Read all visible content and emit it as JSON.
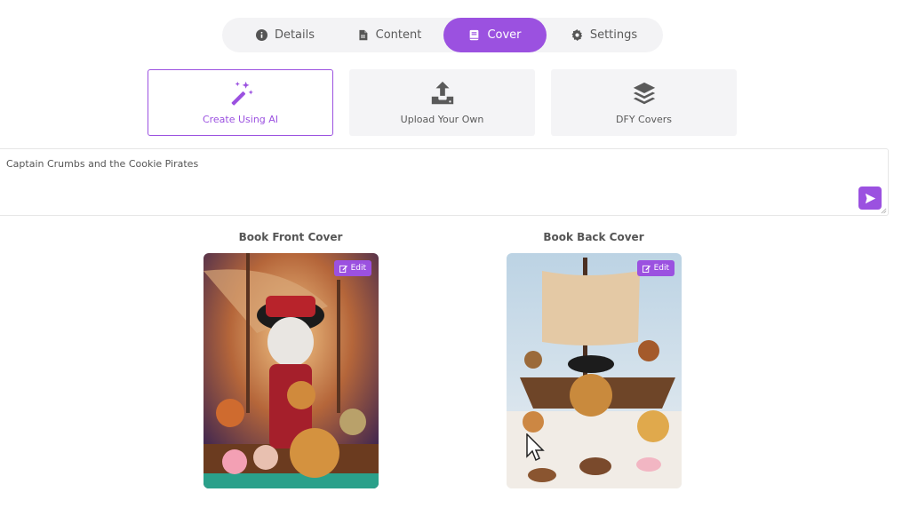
{
  "tabs": [
    {
      "label": "Details",
      "icon": "info-icon"
    },
    {
      "label": "Content",
      "icon": "file-icon"
    },
    {
      "label": "Cover",
      "icon": "book-icon",
      "active": true
    },
    {
      "label": "Settings",
      "icon": "gear-icon"
    }
  ],
  "cover_options": [
    {
      "label": "Create Using AI",
      "icon": "magic-wand-icon",
      "active": true
    },
    {
      "label": "Upload Your Own",
      "icon": "upload-icon"
    },
    {
      "label": "DFY Covers",
      "icon": "layers-icon"
    }
  ],
  "prompt": {
    "value": "Captain Crumbs and the Cookie Pirates"
  },
  "covers": {
    "front": {
      "label": "Book Front Cover",
      "edit_label": "Edit"
    },
    "back": {
      "label": "Book Back Cover",
      "edit_label": "Edit"
    }
  },
  "colors": {
    "accent": "#9b51e0",
    "panel": "#f4f4f6"
  }
}
